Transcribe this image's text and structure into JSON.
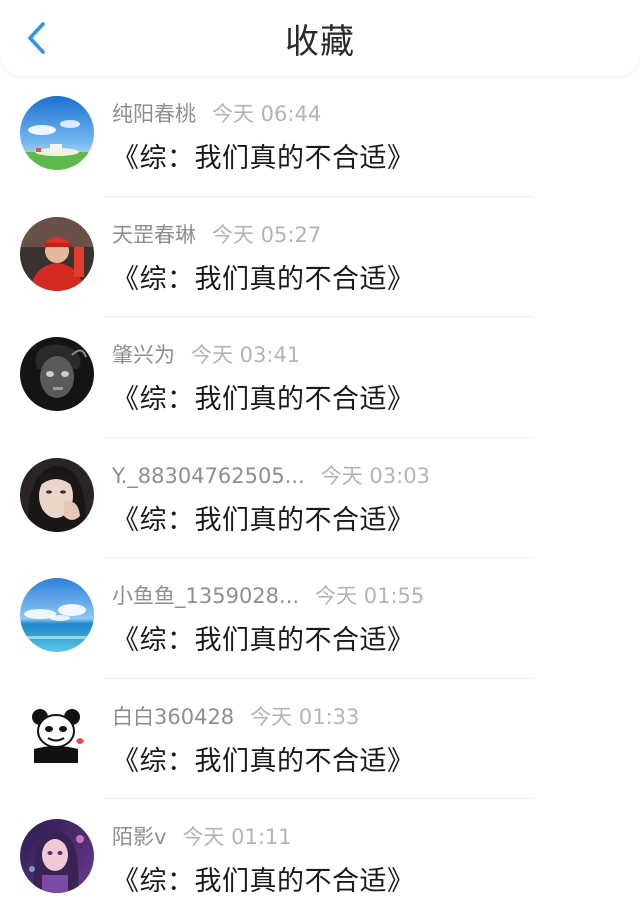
{
  "header": {
    "title": "收藏",
    "back_icon": "chevron-left-icon",
    "accent_color": "#2f96e8"
  },
  "items": [
    {
      "name": "纯阳春桃",
      "time": "今天 06:44",
      "title": "《综：我们真的不合适》",
      "avatar": "sky-landscape-avatar"
    },
    {
      "name": "天罡春琳",
      "time": "今天 05:27",
      "title": "《综：我们真的不合适》",
      "avatar": "red-cap-person-avatar"
    },
    {
      "name": "肇兴为",
      "time": "今天 03:41",
      "title": "《综：我们真的不合适》",
      "avatar": "dark-portrait-avatar"
    },
    {
      "name": "Y._88304762505...",
      "time": "今天 03:03",
      "title": "《综：我们真的不合适》",
      "avatar": "girl-selfie-avatar"
    },
    {
      "name": "小鱼鱼_1359028...",
      "time": "今天 01:55",
      "title": "《综：我们真的不合适》",
      "avatar": "ocean-sky-avatar"
    },
    {
      "name": "白白360428",
      "time": "今天 01:33",
      "title": "《综：我们真的不合适》",
      "avatar": "panda-meme-avatar"
    },
    {
      "name": "陌影v",
      "time": "今天 01:11",
      "title": "《综：我们真的不合适》",
      "avatar": "anime-girl-avatar"
    }
  ]
}
